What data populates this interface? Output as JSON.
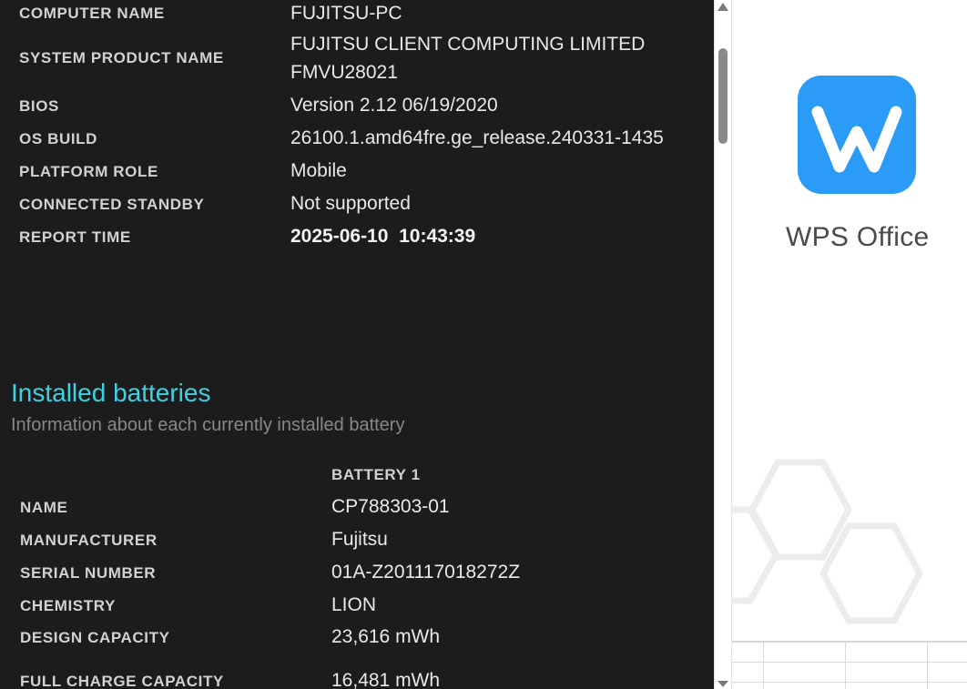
{
  "system_info": {
    "rows": [
      {
        "label": "COMPUTER NAME",
        "value": "FUJITSU-PC"
      },
      {
        "label": "SYSTEM PRODUCT NAME",
        "value_line1": "FUJITSU CLIENT COMPUTING LIMITED",
        "value_line2": "FMVU28021"
      },
      {
        "label": "BIOS",
        "value": "Version 2.12 06/19/2020"
      },
      {
        "label": "OS BUILD",
        "value": "26100.1.amd64fre.ge_release.240331-1435"
      },
      {
        "label": "PLATFORM ROLE",
        "value": "Mobile"
      },
      {
        "label": "CONNECTED STANDBY",
        "value": "Not supported"
      },
      {
        "label": "REPORT TIME",
        "value": "2025-06-10  10:43:39"
      }
    ]
  },
  "installed_batteries": {
    "title": "Installed batteries",
    "subtitle": "Information about each currently installed battery",
    "column_header": "BATTERY 1",
    "rows": [
      {
        "label": "NAME",
        "value": "CP788303-01"
      },
      {
        "label": "MANUFACTURER",
        "value": "Fujitsu"
      },
      {
        "label": "SERIAL NUMBER",
        "value": "01A-Z201117018272Z"
      },
      {
        "label": "CHEMISTRY",
        "value": "LION"
      },
      {
        "label": "DESIGN CAPACITY",
        "value": "23,616 mWh"
      },
      {
        "label": "FULL CHARGE CAPACITY",
        "value": "16,481 mWh"
      }
    ]
  },
  "scrollbar": {
    "position": 0.07
  },
  "wps_splash": {
    "app_name": "WPS Office",
    "logo_icon": "wps-w-logo-icon",
    "brand_color": "#2a9bf7"
  },
  "colors": {
    "report_background": "#1c1c1c",
    "section_title": "#3fd0e2",
    "label_text": "#d2d2d2",
    "subtitle_text": "#888888"
  }
}
